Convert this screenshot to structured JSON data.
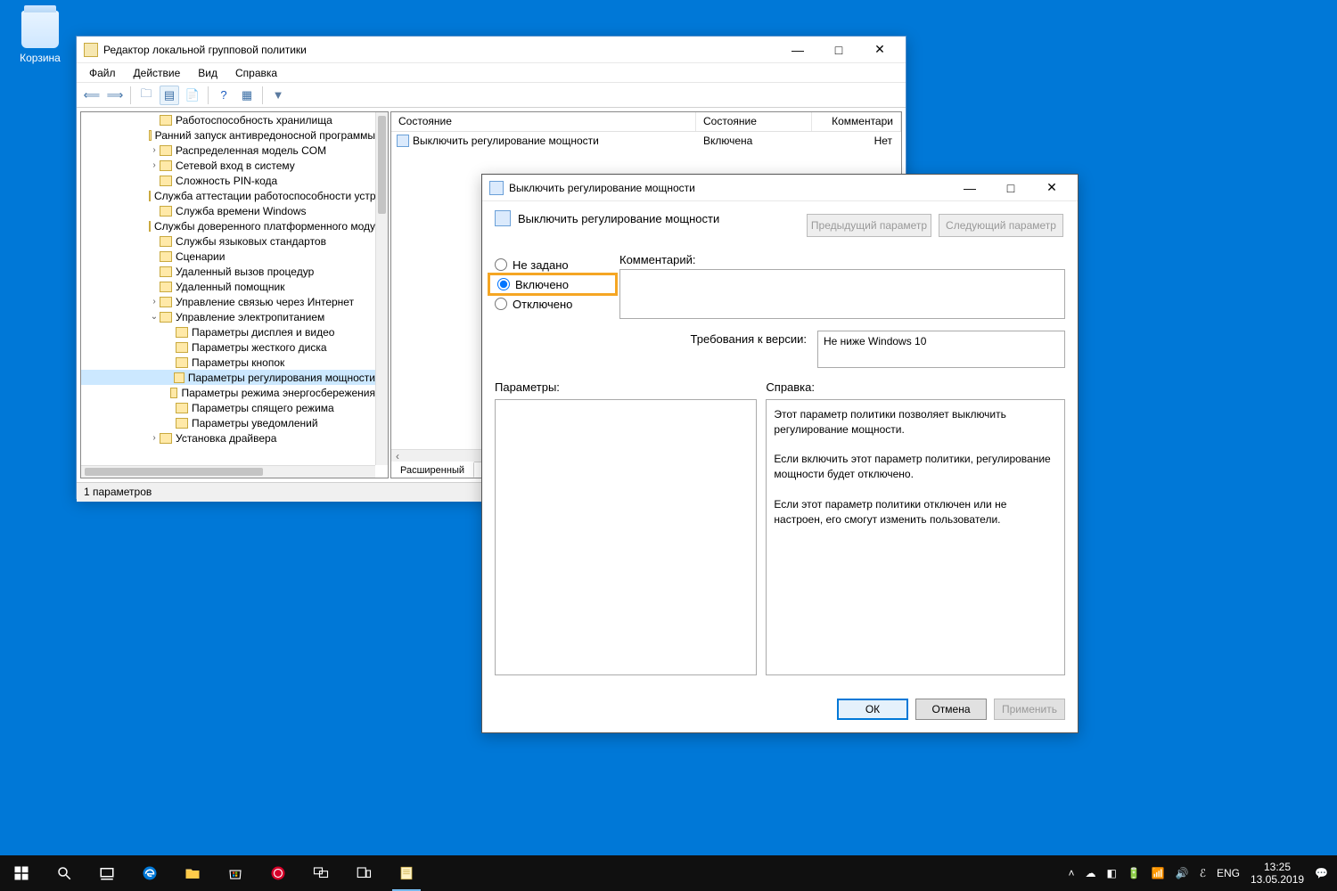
{
  "desktop": {
    "recycle_label": "Корзина"
  },
  "gpedit": {
    "title": "Редактор локальной групповой политики",
    "menu": [
      "Файл",
      "Действие",
      "Вид",
      "Справка"
    ],
    "tree": [
      {
        "indent": 76,
        "label": "Работоспособность хранилища"
      },
      {
        "indent": 76,
        "label": "Ранний запуск антивредоносной программы"
      },
      {
        "indent": 76,
        "caret": "›",
        "label": "Распределенная модель COM"
      },
      {
        "indent": 76,
        "caret": "›",
        "label": "Сетевой вход в систему"
      },
      {
        "indent": 76,
        "label": "Сложность PIN-кода"
      },
      {
        "indent": 76,
        "label": "Служба аттестации работоспособности устр"
      },
      {
        "indent": 76,
        "label": "Служба времени Windows"
      },
      {
        "indent": 76,
        "label": "Службы доверенного платформенного моду"
      },
      {
        "indent": 76,
        "label": "Службы языковых стандартов"
      },
      {
        "indent": 76,
        "label": "Сценарии"
      },
      {
        "indent": 76,
        "label": "Удаленный вызов процедур"
      },
      {
        "indent": 76,
        "label": "Удаленный помощник"
      },
      {
        "indent": 76,
        "caret": "›",
        "label": "Управление связью через Интернет"
      },
      {
        "indent": 76,
        "caret": "⌄",
        "label": "Управление электропитанием"
      },
      {
        "indent": 94,
        "label": "Параметры дисплея и видео"
      },
      {
        "indent": 94,
        "label": "Параметры жесткого диска"
      },
      {
        "indent": 94,
        "label": "Параметры кнопок"
      },
      {
        "indent": 94,
        "label": "Параметры регулирования мощности",
        "selected": true
      },
      {
        "indent": 94,
        "label": "Параметры режима энергосбережения"
      },
      {
        "indent": 94,
        "label": "Параметры спящего режима"
      },
      {
        "indent": 94,
        "label": "Параметры уведомлений"
      },
      {
        "indent": 76,
        "caret": "›",
        "label": "Установка драйвера"
      }
    ],
    "headers": {
      "name": "Состояние",
      "state": "Состояние",
      "comment": "Комментари"
    },
    "row": {
      "name": "Выключить регулирование мощности",
      "state": "Включена",
      "comment": "Нет"
    },
    "tab": "Расширенный",
    "status": "1 параметров"
  },
  "policy": {
    "title": "Выключить регулирование мощности",
    "heading": "Выключить регулирование мощности",
    "prev_btn": "Предыдущий параметр",
    "next_btn": "Следующий параметр",
    "radio_not_configured": "Не задано",
    "radio_enabled": "Включено",
    "radio_disabled": "Отключено",
    "comment_label": "Комментарий:",
    "requirements_label": "Требования к версии:",
    "requirements_text": "Не ниже Windows 10",
    "params_label": "Параметры:",
    "help_label": "Справка:",
    "help_text": "Этот параметр политики позволяет выключить регулирование мощности.\n\nЕсли включить этот параметр политики, регулирование мощности будет отключено.\n\nЕсли этот параметр политики отключен или не настроен, его смогут изменить пользователи.",
    "ok": "ОК",
    "cancel": "Отмена",
    "apply": "Применить"
  },
  "taskbar": {
    "lang": "ENG",
    "time": "13:25",
    "date": "13.05.2019"
  }
}
